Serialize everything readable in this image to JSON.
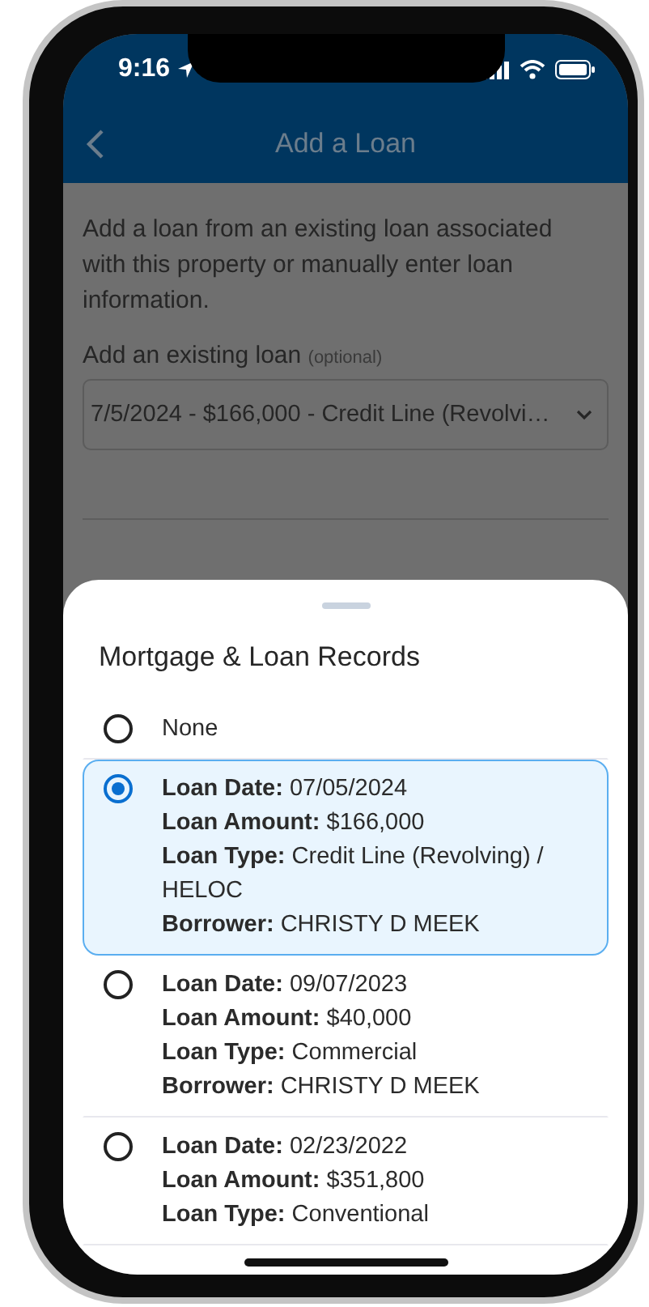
{
  "status_bar": {
    "time": "9:16"
  },
  "header": {
    "title": "Add a Loan"
  },
  "intro": "Add a loan from an existing loan associated with this property or manually enter loan information.",
  "existing_loan": {
    "label": "Add an existing loan",
    "hint": "(optional)",
    "value": "7/5/2024 - $166,000 - Credit Line (Revolvi…"
  },
  "sheet": {
    "title": "Mortgage & Loan Records",
    "options": [
      {
        "selected": false,
        "lines": [
          "None"
        ]
      },
      {
        "selected": true,
        "lines": [
          "**Loan Date:** 07/05/2024",
          "**Loan Amount:** $166,000",
          "**Loan Type:** Credit Line (Revolving) / HELOC",
          "**Borrower:** CHRISTY D MEEK"
        ]
      },
      {
        "selected": false,
        "lines": [
          "**Loan Date:** 09/07/2023",
          "**Loan Amount:** $40,000",
          "**Loan Type:** Commercial",
          "**Borrower:** CHRISTY D MEEK"
        ]
      },
      {
        "selected": false,
        "lines": [
          "**Loan Date:** 02/23/2022",
          "**Loan Amount:** $351,800",
          "**Loan Type:** Conventional"
        ]
      }
    ]
  }
}
